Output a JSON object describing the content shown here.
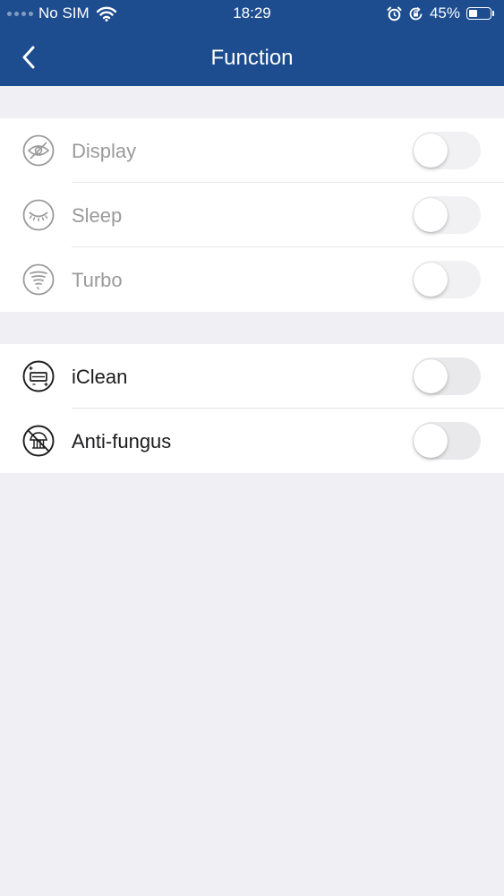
{
  "status_bar": {
    "carrier": "No SIM",
    "time": "18:29",
    "battery": "45%",
    "battery_level": 0.45
  },
  "nav": {
    "title": "Function"
  },
  "groups": [
    {
      "items": [
        {
          "label": "Display",
          "icon": "eye-off-icon",
          "enabled": false,
          "on": false
        },
        {
          "label": "Sleep",
          "icon": "sleep-icon",
          "enabled": false,
          "on": false
        },
        {
          "label": "Turbo",
          "icon": "turbo-icon",
          "enabled": false,
          "on": false
        }
      ]
    },
    {
      "items": [
        {
          "label": "iClean",
          "icon": "iclean-icon",
          "enabled": true,
          "on": false
        },
        {
          "label": "Anti-fungus",
          "icon": "anti-fungus-icon",
          "enabled": true,
          "on": false
        }
      ]
    }
  ],
  "colors": {
    "header": "#1d4d8f",
    "background": "#efeff4",
    "disabled_text": "#9a9a9a",
    "enabled_text": "#1c1c1e"
  }
}
